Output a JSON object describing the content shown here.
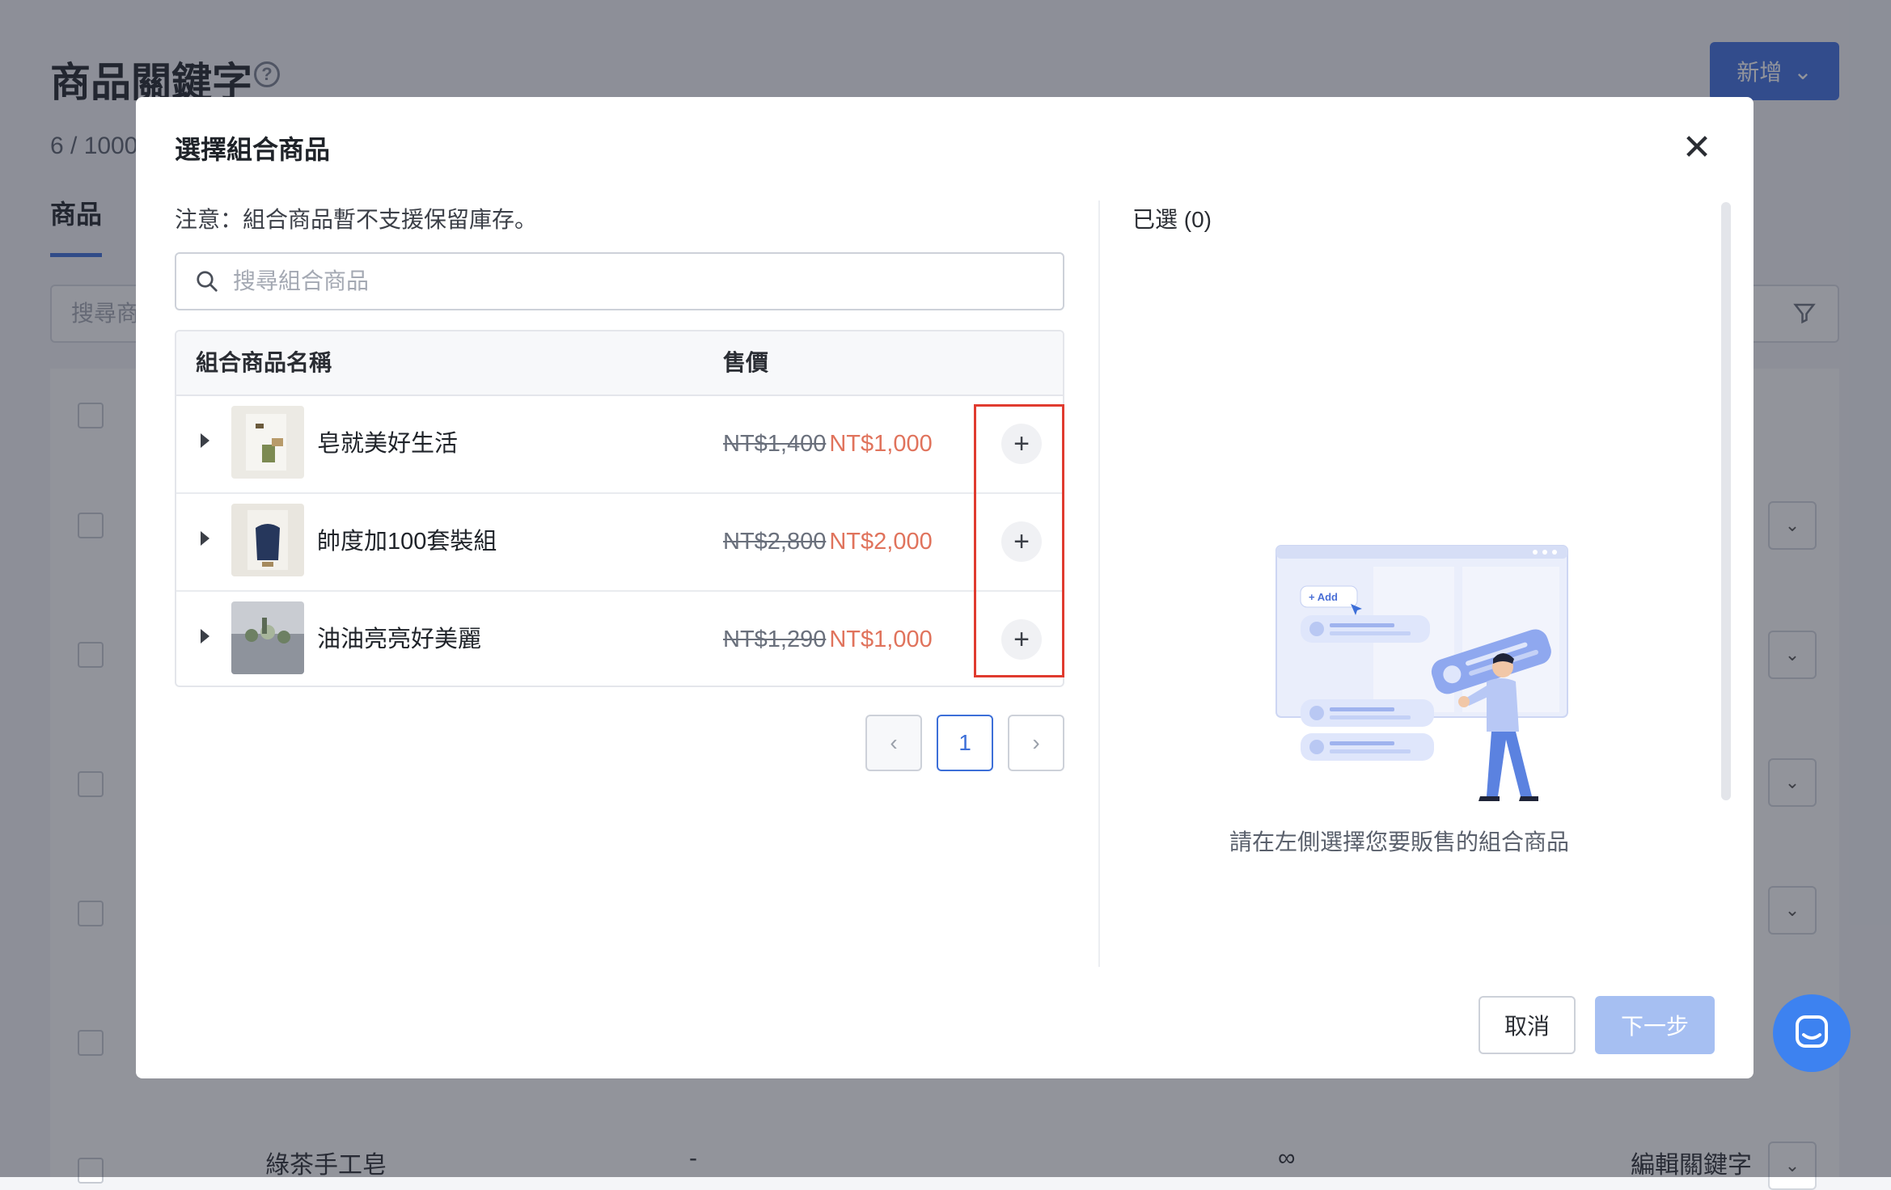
{
  "page": {
    "title": "商品關鍵字",
    "count": "6 / 1000",
    "tab": "商品",
    "add_button": "新增",
    "search_placeholder": "搜尋商",
    "last_row": {
      "name": "綠茶手工皂",
      "dash": "-",
      "infinity": "∞",
      "edit_button": "編輯關鍵字"
    }
  },
  "modal": {
    "title": "選擇組合商品",
    "note": "注意：組合商品暫不支援保留庫存。",
    "search_placeholder": "搜尋組合商品",
    "columns": {
      "name": "組合商品名稱",
      "price": "售價"
    },
    "rows": [
      {
        "name": "皂就美好生活",
        "original_price": "NT$1,400",
        "sale_price": "NT$1,000",
        "add": "+"
      },
      {
        "name": "帥度加100套裝組",
        "original_price": "NT$2,800",
        "sale_price": "NT$2,000",
        "add": "+"
      },
      {
        "name": "油油亮亮好美麗",
        "original_price": "NT$1,290",
        "sale_price": "NT$1,000",
        "add": "+"
      }
    ],
    "pagination": {
      "prev": "‹",
      "current_page": "1",
      "next": "›"
    },
    "selected_label": "已選 (0)",
    "illustration_button": "+ Add",
    "empty_text": "請在左側選擇您要販售的組合商品",
    "cancel_button": "取消",
    "next_button": "下一步"
  },
  "colors": {
    "accent": "#3d6fd8",
    "sale": "#e0735c",
    "highlight": "#e03b2f",
    "next_disabled": "#a6bff2",
    "chat": "#3d82f0"
  }
}
